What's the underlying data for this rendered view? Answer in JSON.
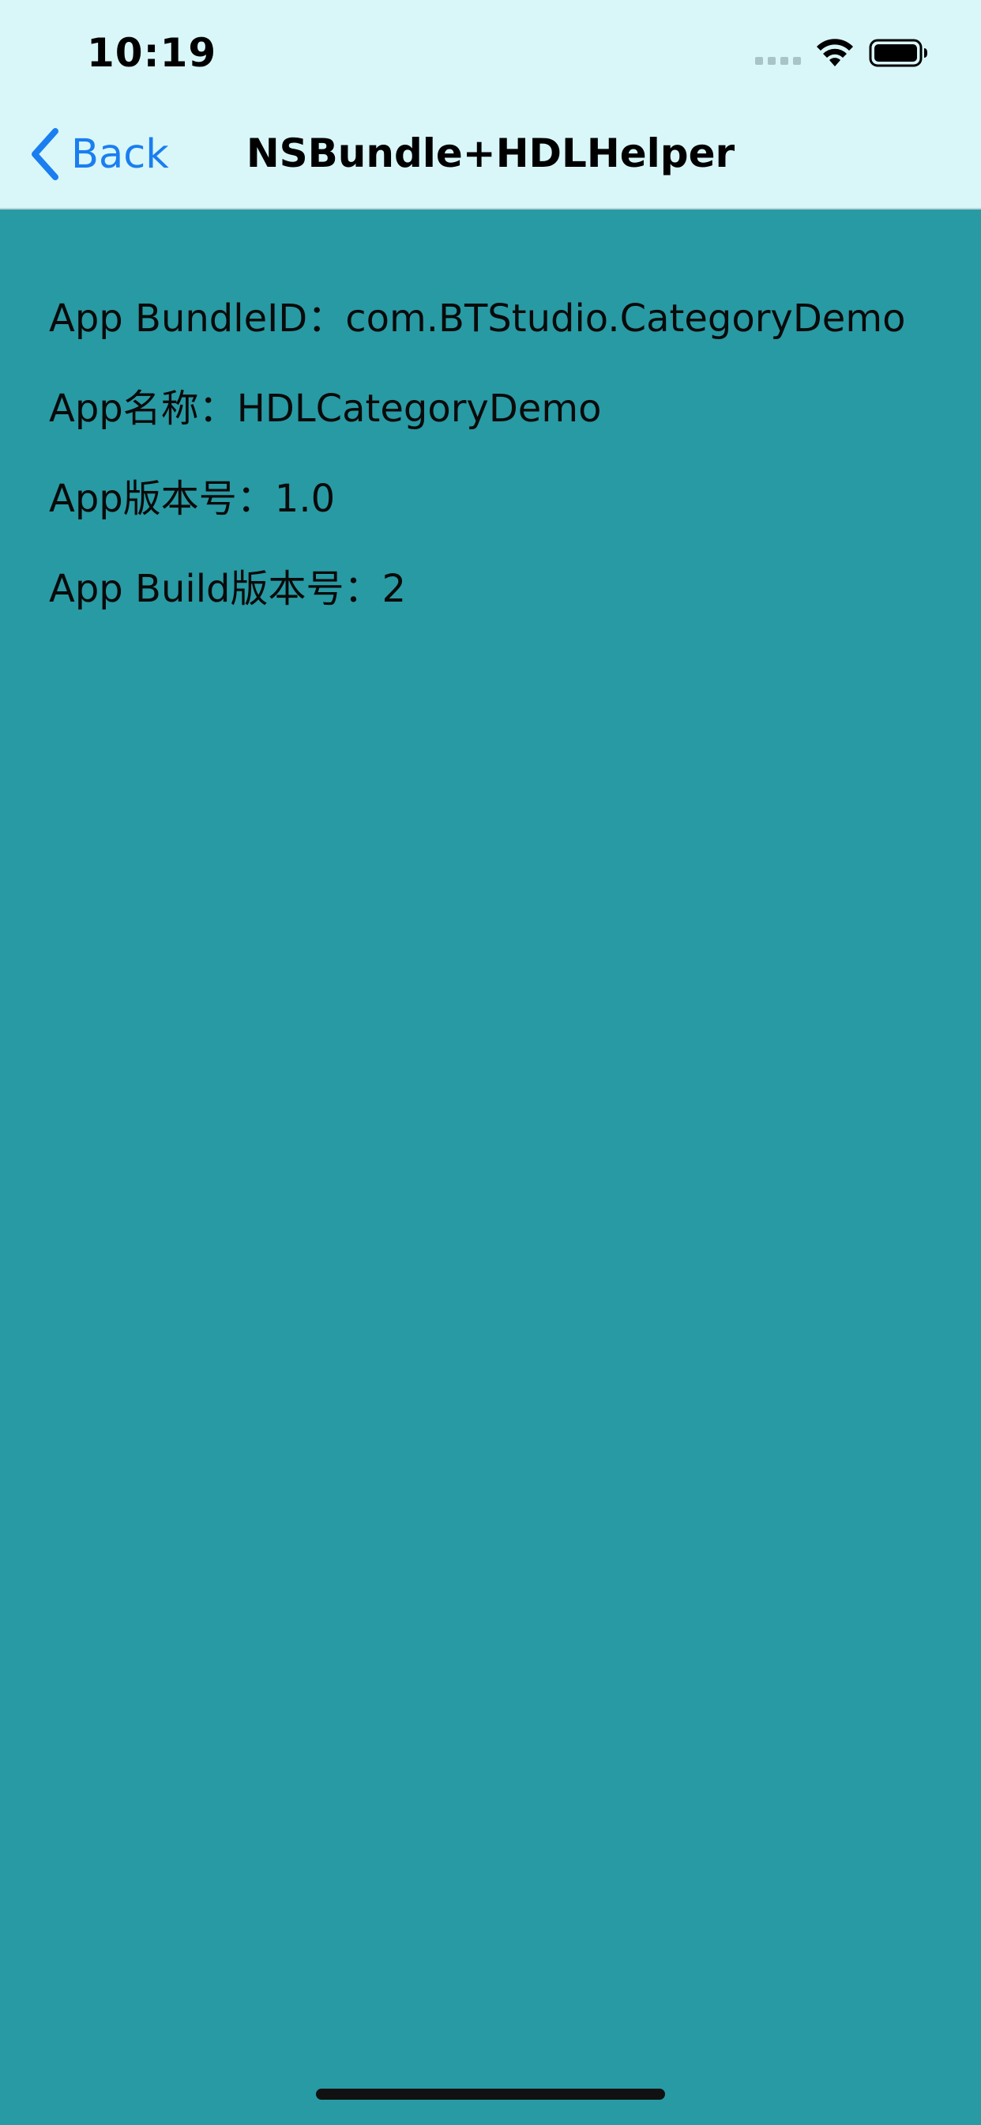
{
  "status_bar": {
    "time": "10:19",
    "icons": [
      "cellular-signal-icon",
      "wifi-icon",
      "battery-icon"
    ]
  },
  "nav_bar": {
    "back_label": "Back",
    "title": "NSBundle+HDLHelper"
  },
  "info": {
    "bundle_id_line": "App BundleID：com.BTStudio.CategoryDemo",
    "app_name_line": "App名称：HDLCategoryDemo",
    "version_line": "App版本号：1.0",
    "build_line": "App Build版本号：2"
  },
  "colors": {
    "nav_background": "#d9f7f9",
    "content_background": "#289aa4",
    "accent": "#1a7ef0"
  }
}
